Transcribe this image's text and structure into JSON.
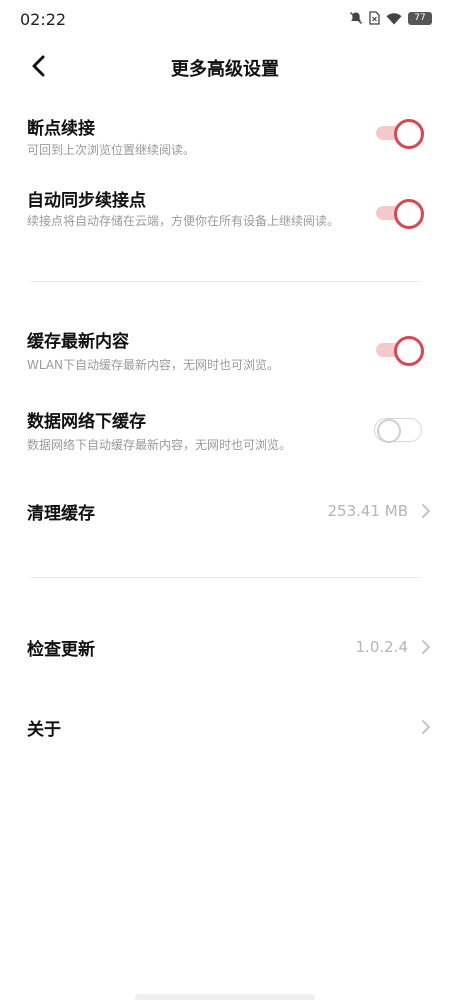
{
  "status_bar": {
    "time": "02:22",
    "battery": "77"
  },
  "header": {
    "title": "更多高级设置"
  },
  "settings": [
    {
      "title": "断点续接",
      "desc": "可回到上次浏览位置继续阅读。",
      "enabled": true
    },
    {
      "title": "自动同步续接点",
      "desc": "续接点将自动存储在云端，方便你在所有设备上继续阅读。",
      "enabled": true
    },
    {
      "title": "缓存最新内容",
      "desc": "WLAN下自动缓存最新内容，无网时也可浏览。",
      "enabled": true
    },
    {
      "title": "数据网络下缓存",
      "desc": "数据网络下自动缓存最新内容，无网时也可浏览。",
      "enabled": false
    }
  ],
  "clear_cache": {
    "label": "清理缓存",
    "value": "253.41 MB"
  },
  "check_update": {
    "label": "检查更新",
    "value": "1.0.2.4"
  },
  "about": {
    "label": "关于"
  },
  "colors": {
    "accent": "#d9474f",
    "accent_track": "#f5c9cc"
  }
}
